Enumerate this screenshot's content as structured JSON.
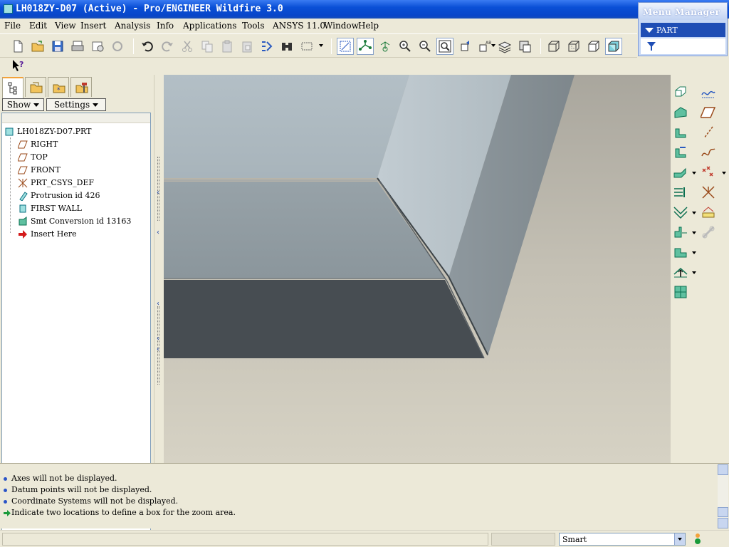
{
  "window": {
    "title": "LH018ZY-D07 (Active) - Pro/ENGINEER Wildfire 3.0"
  },
  "menubar": {
    "items": [
      "File",
      "Edit",
      "View",
      "Insert",
      "Analysis",
      "Info",
      "Applications",
      "Tools",
      "ANSYS 11.0",
      "Window",
      "Help"
    ]
  },
  "menu_manager": {
    "title": "Menu Manager",
    "item": "PART"
  },
  "model_tree": {
    "show_label": "Show",
    "settings_label": "Settings",
    "root": "LH018ZY-D07.PRT",
    "items": [
      {
        "label": "RIGHT",
        "icon": "datum-plane-icon"
      },
      {
        "label": "TOP",
        "icon": "datum-plane-icon"
      },
      {
        "label": "FRONT",
        "icon": "datum-plane-icon"
      },
      {
        "label": "PRT_CSYS_DEF",
        "icon": "coordinate-system-icon"
      },
      {
        "label": "Protrusion id 426",
        "icon": "protrusion-icon"
      },
      {
        "label": "FIRST WALL",
        "icon": "first-wall-icon"
      },
      {
        "label": "Smt Conversion id 13163",
        "icon": "sheetmetal-conversion-icon"
      },
      {
        "label": "Insert Here",
        "icon": "insert-here-arrow-icon"
      }
    ]
  },
  "messages": [
    {
      "text": "Axes will not be displayed.",
      "type": "info"
    },
    {
      "text": "Datum points will not be displayed.",
      "type": "info"
    },
    {
      "text": "Coordinate Systems will not be displayed.",
      "type": "info"
    },
    {
      "text": "Indicate two locations to define a box for the zoom area.",
      "type": "prompt"
    }
  ],
  "status": {
    "filter_value": "Smart"
  },
  "colors": {
    "title_bar": "#0a4fd6",
    "chrome": "#ece9d8",
    "model_light": "#b9c2c6",
    "model_mid": "#8e979c",
    "model_dark": "#474d52"
  }
}
